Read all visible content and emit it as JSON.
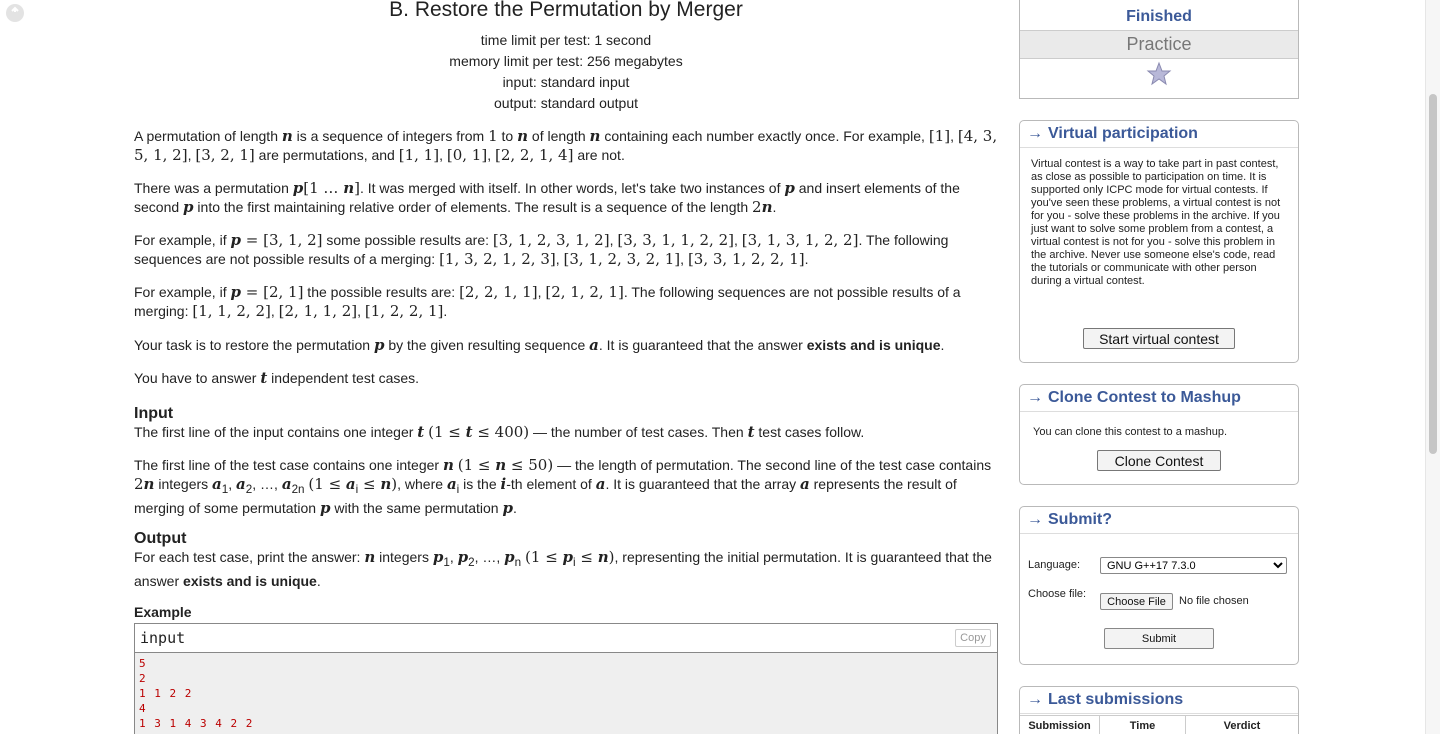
{
  "problem": {
    "title": "B. Restore the Permutation by Merger",
    "time_limit": "time limit per test: 1 second",
    "memory_limit": "memory limit per test: 256 megabytes",
    "input_file": "input: standard input",
    "output_file": "output: standard output",
    "input_heading": "Input",
    "output_heading": "Output",
    "example_heading": "Example",
    "sample_input_title": "input",
    "copy_label": "Copy",
    "sample_input_lines": [
      "5",
      "2",
      "1 1 2 2",
      "4",
      "1 3 1 4 3 4 2 2"
    ]
  },
  "sidebar": {
    "status_finished": "Finished",
    "status_practice": "Practice",
    "virtual": {
      "title": "Virtual participation",
      "text": "Virtual contest is a way to take part in past contest, as close as possible to participation on time. It is supported only ICPC mode for virtual contests. If you've seen these problems, a virtual contest is not for you - solve these problems in the archive. If you just want to solve some problem from a contest, a virtual contest is not for you - solve this problem in the archive. Never use someone else's code, read the tutorials or communicate with other person during a virtual contest.",
      "button": "Start virtual contest"
    },
    "clone": {
      "title": "Clone Contest to Mashup",
      "text": "You can clone this contest to a mashup.",
      "button": "Clone Contest"
    },
    "submit": {
      "title": "Submit?",
      "language_label": "Language:",
      "language_value": "GNU G++17 7.3.0",
      "file_label": "Choose file:",
      "choose_file_button": "Choose File",
      "no_file": "No file chosen",
      "submit_button": "Submit"
    },
    "last_submissions": {
      "title": "Last submissions",
      "columns": [
        "Submission",
        "Time",
        "Verdict"
      ]
    }
  }
}
